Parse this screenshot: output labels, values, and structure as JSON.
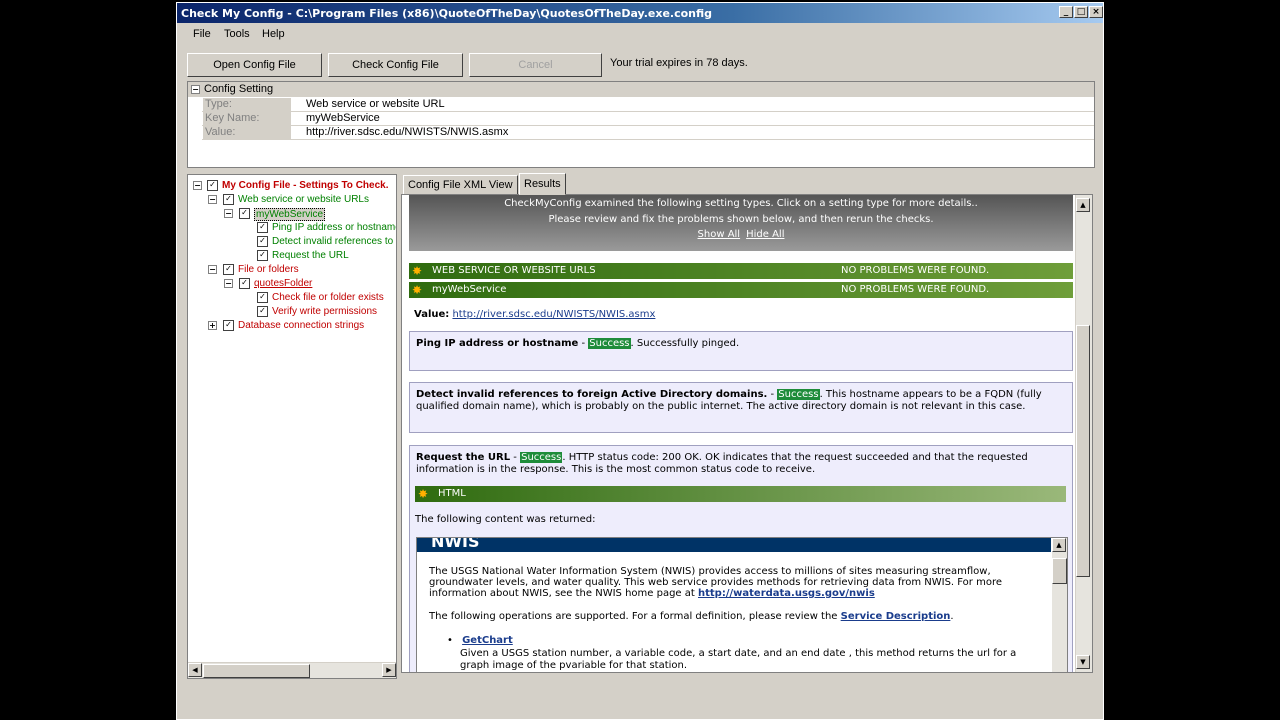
{
  "window": {
    "title": "Check My Config - C:\\Program Files (x86)\\QuoteOfTheDay\\QuotesOfTheDay.exe.config"
  },
  "menu": {
    "file": "File",
    "tools": "Tools",
    "help": "Help"
  },
  "toolbar": {
    "open": "Open Config File",
    "check": "Check Config File",
    "cancel": "Cancel",
    "trial": "Your trial expires in 78 days."
  },
  "config": {
    "header": "Config Setting",
    "rows": [
      {
        "key": "Type:",
        "value": "Web service or website URL"
      },
      {
        "key": "Key Name:",
        "value": "myWebService"
      },
      {
        "key": "Value:",
        "value": "http://river.sdsc.edu/NWISTS/NWIS.asmx"
      }
    ]
  },
  "tree": {
    "root": "My Config File - Settings To Check.",
    "web": "Web service or website URLs",
    "svc": "myWebService",
    "ping": "Ping IP address or hostname",
    "detect": "Detect invalid references to f",
    "request": "Request the URL",
    "files": "File or folders",
    "folder": "quotesFolder",
    "exists": "Check file or folder exists",
    "verify": "Verify write permissions",
    "db": "Database connection strings"
  },
  "tabs": {
    "xml": "Config File XML View",
    "results": "Results"
  },
  "results": {
    "banner_l1": "CheckMyConfig examined the following setting types. Click on a setting type for more details..",
    "banner_l2": "Please review and fix the problems shown below, and then rerun the checks.",
    "show_all": "Show All",
    "hide_all": "Hide All",
    "bar1_name": "WEB SERVICE OR WEBSITE URLS",
    "bar1_status": "NO PROBLEMS WERE FOUND.",
    "bar2_name": "myWebService",
    "bar2_status": "NO PROBLEMS WERE FOUND.",
    "value_label": "Value:",
    "value_url": "http://river.sdsc.edu/NWISTS/NWIS.asmx",
    "ping_title": "Ping IP address or hostname",
    "success": "Success",
    "ping_text": ". Successfully pinged.",
    "detect_title": "Detect invalid references to foreign Active Directory domains.",
    "detect_text": ". This hostname appears to be a FQDN (fully",
    "detect_text2": "qualified domain name), which is probably on the public internet. The active directory domain is not relevant in this case.",
    "request_title": "Request the URL",
    "request_text": ". HTTP status code: 200 OK. OK indicates that the request succeeded and that the requested",
    "request_text2": "information is in the response. This is the most common status code to receive.",
    "html_bar": "HTML",
    "returned": "The following content was returned:",
    "nwis_header": "NWIS",
    "nwis_p1a": "The USGS National Water Information System (NWIS) provides access to millions of sites measuring streamflow,",
    "nwis_p1b": "groundwater levels, and water quality. This web service provides methods for retrieving data from NWIS. For more",
    "nwis_p1c": "information about NWIS, see the NWIS home page at",
    "nwis_link": "http://waterdata.usgs.gov/nwis",
    "nwis_p2": "The following operations are supported. For a formal definition, please review the",
    "service_desc": "Service Description",
    "getchart": "GetChart",
    "getchart_a": "Given a USGS station number, a variable code, a start date, and an end date , this method returns the url for a",
    "getchart_b": "graph image of the pvariable for that station."
  }
}
